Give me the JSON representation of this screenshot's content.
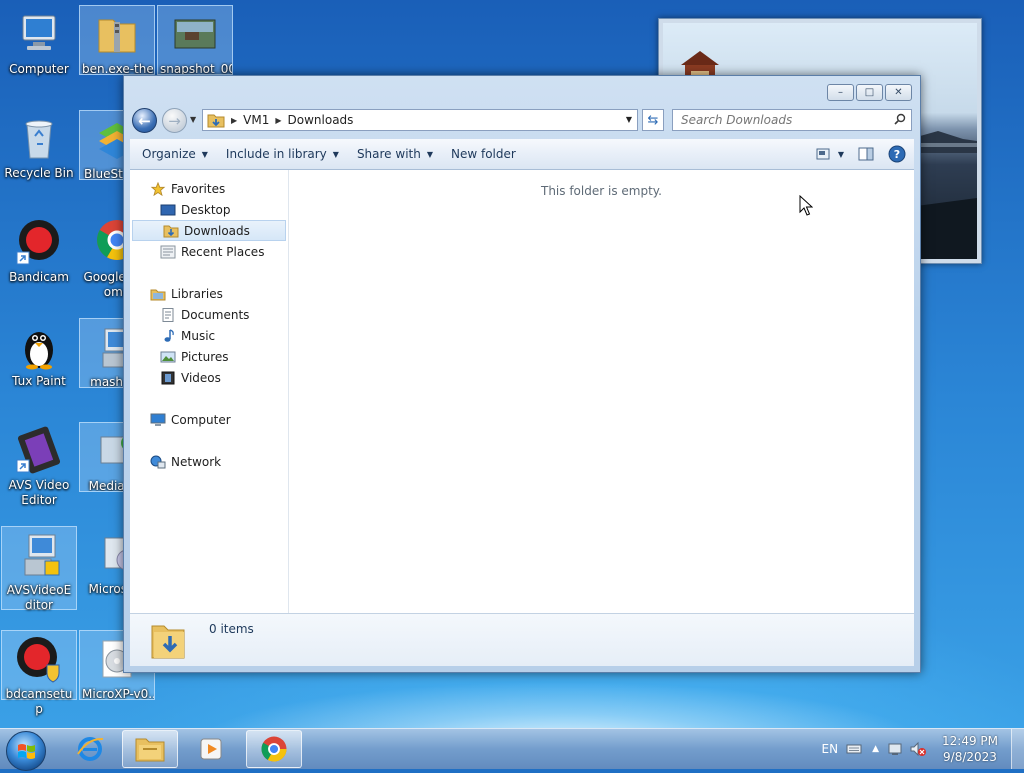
{
  "desktop": {
    "icons": [
      {
        "label": "Computer"
      },
      {
        "label": "ben.exe-the..."
      },
      {
        "label": "snapshot_001"
      },
      {
        "label": "Recycle Bin"
      },
      {
        "label": "BlueStacks"
      },
      {
        "label": "Bandicam"
      },
      {
        "label": "Google Chrome"
      },
      {
        "label": "Tux Paint"
      },
      {
        "label": "mash_f..."
      },
      {
        "label": "AVS Video Editor"
      },
      {
        "label": "MediaG..."
      },
      {
        "label": "AVSVideoEditor"
      },
      {
        "label": "Microso..."
      },
      {
        "label": "bdcamsetup"
      },
      {
        "label": "MicroXP-v0..."
      }
    ]
  },
  "window": {
    "buttons": {
      "minimize": "–",
      "maximize": "□",
      "close": "✕"
    },
    "address": {
      "root": "VM1",
      "folder": "Downloads"
    },
    "search": {
      "placeholder": "Search Downloads"
    },
    "toolbar": {
      "organize": "Organize",
      "include_in_library": "Include in library",
      "share_with": "Share with",
      "new_folder": "New folder"
    },
    "nav": {
      "favorites": "Favorites",
      "desktop": "Desktop",
      "downloads": "Downloads",
      "recent_places": "Recent Places",
      "libraries": "Libraries",
      "documents": "Documents",
      "music": "Music",
      "pictures": "Pictures",
      "videos": "Videos",
      "computer": "Computer",
      "network": "Network"
    },
    "empty_message": "This folder is empty.",
    "details": {
      "item_count": "0 items"
    }
  },
  "taskbar": {
    "language": "EN",
    "time": "12:49 PM",
    "date": "9/8/2023"
  },
  "colors": {
    "accent": "#2d6bb5",
    "toolbar_text": "#1e395b"
  }
}
